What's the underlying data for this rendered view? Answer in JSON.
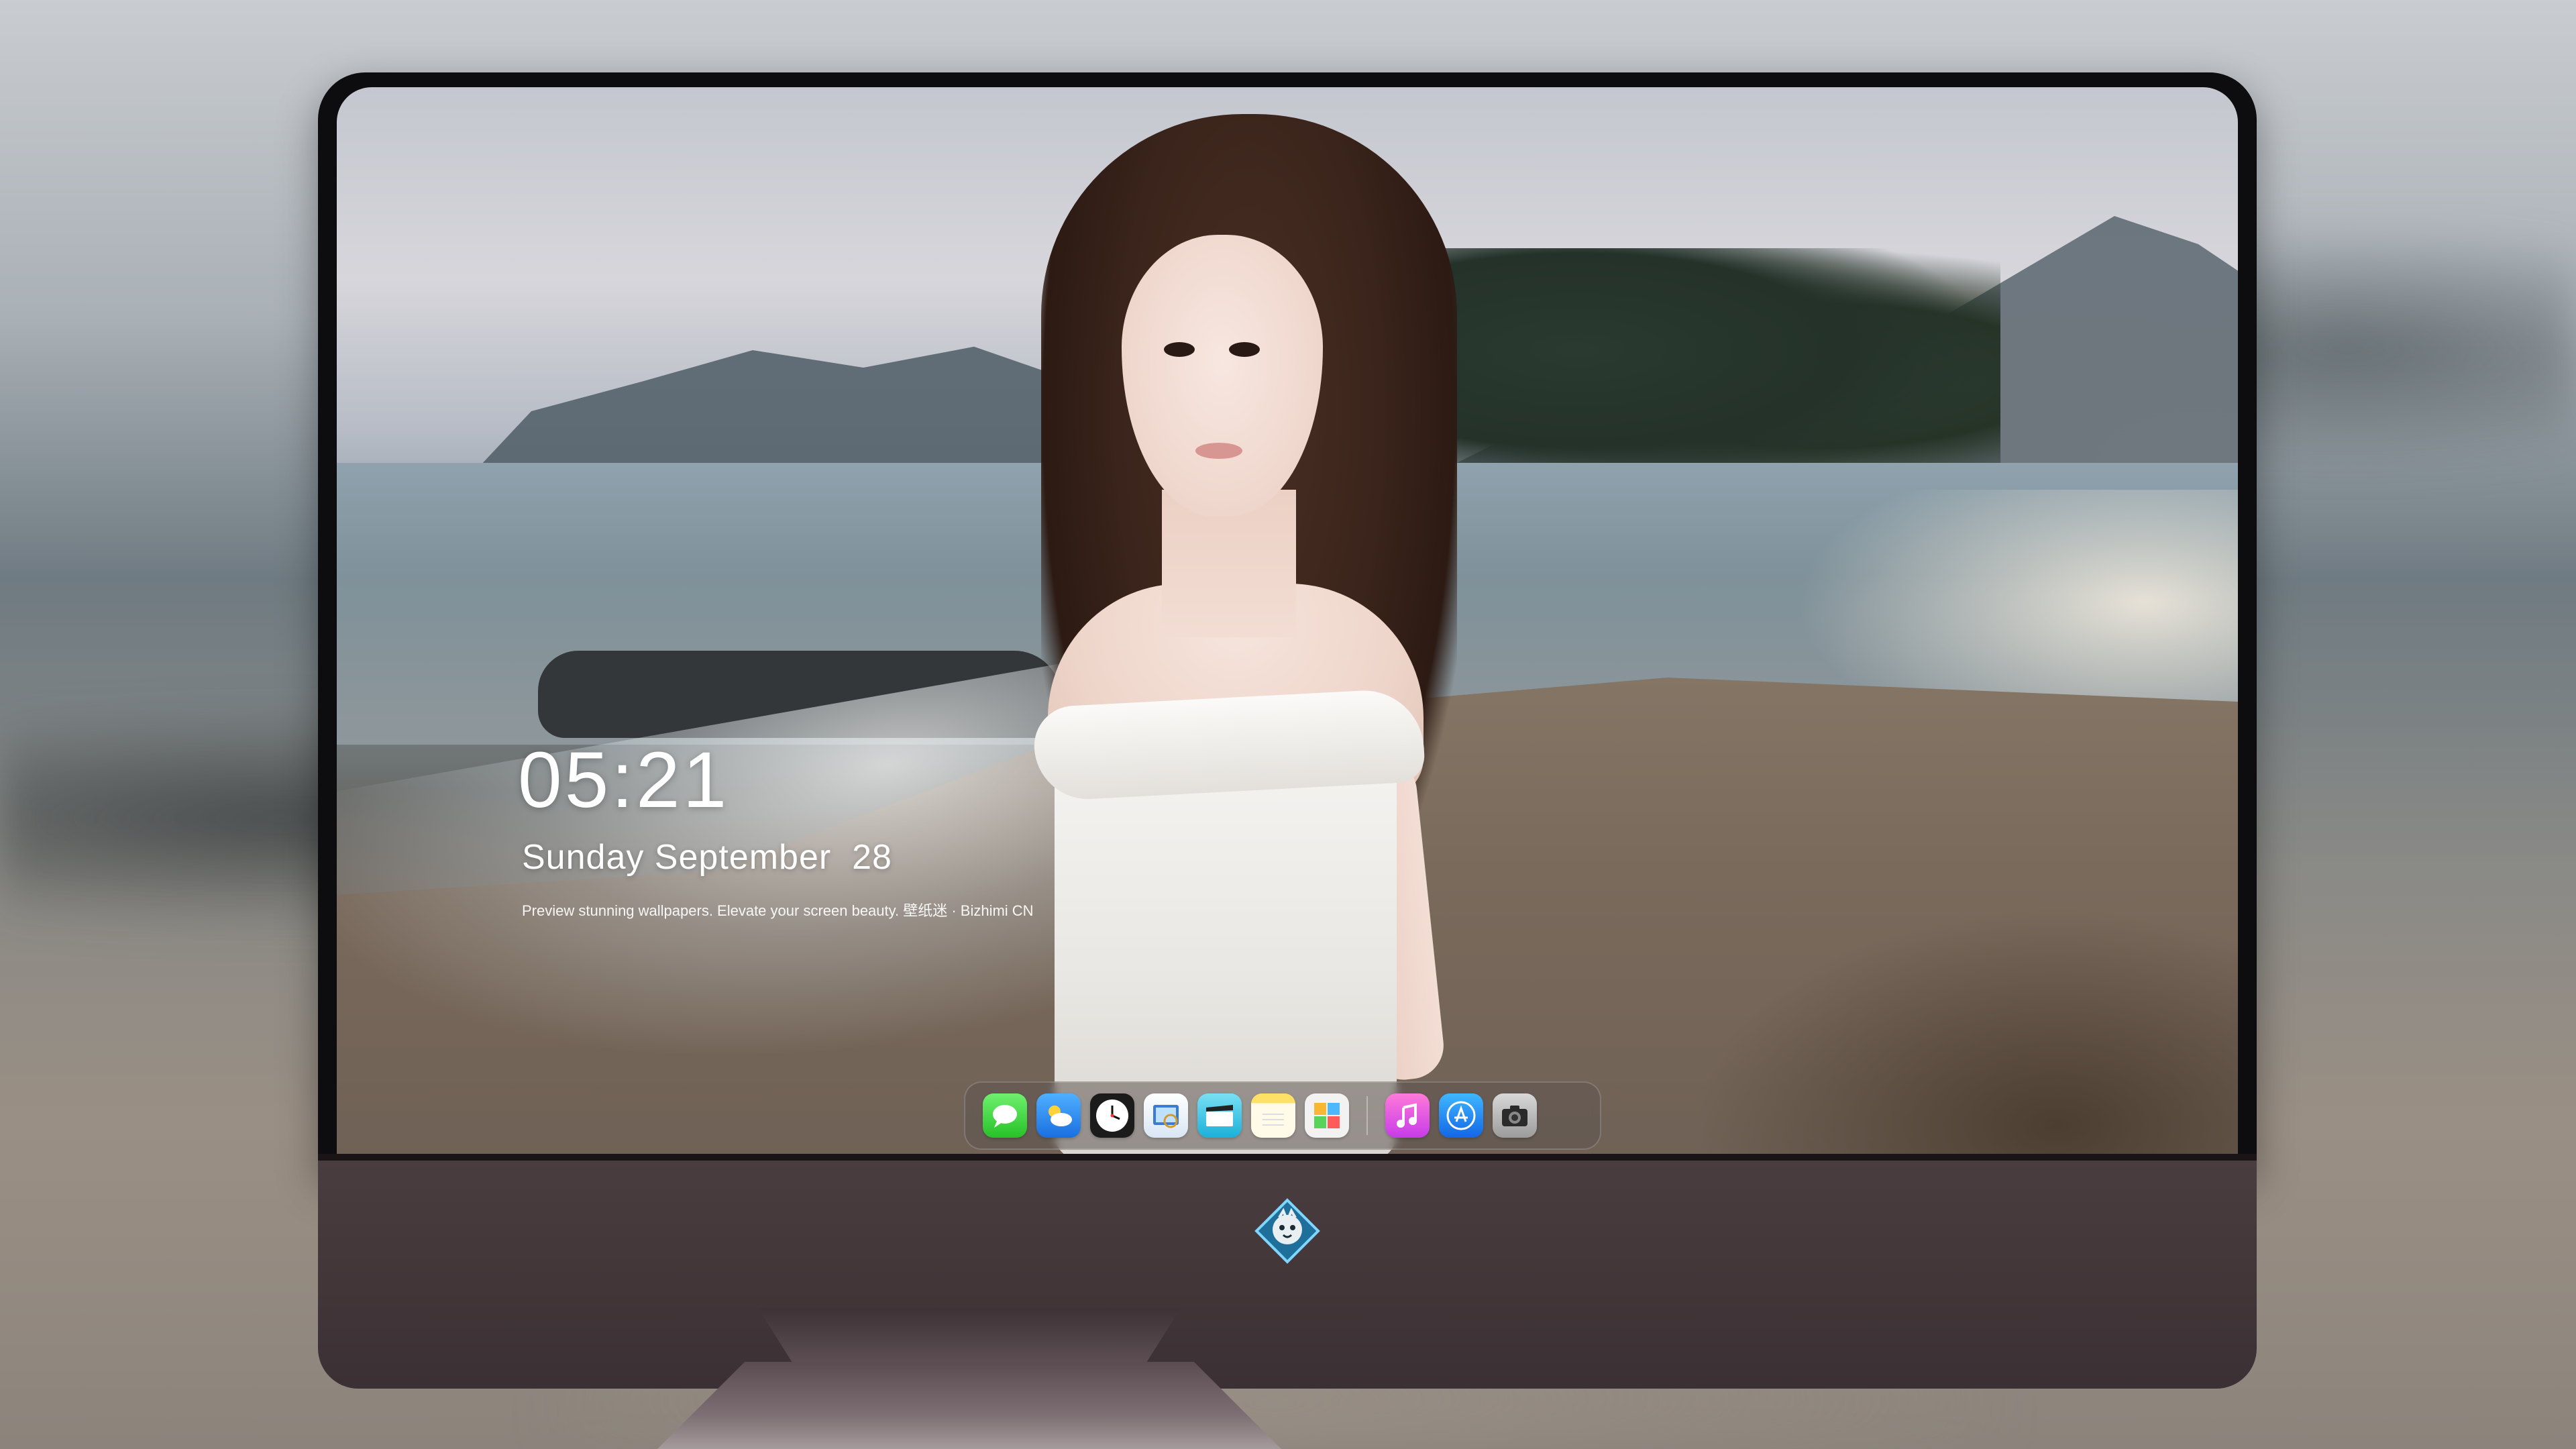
{
  "lockscreen": {
    "time": "05:21",
    "date": "Sunday September  28",
    "tagline": "Preview stunning wallpapers. Elevate your screen beauty. 壁纸迷 · Bizhimi CN"
  },
  "dock": {
    "apps": [
      {
        "name": "messages-icon"
      },
      {
        "name": "weather-icon"
      },
      {
        "name": "clock-icon"
      },
      {
        "name": "preview-icon"
      },
      {
        "name": "video-icon"
      },
      {
        "name": "notes-icon"
      },
      {
        "name": "photos-icon"
      },
      {
        "name": "music-icon"
      },
      {
        "name": "app-store-icon"
      },
      {
        "name": "camera-icon"
      }
    ]
  },
  "colors": {
    "monitor_bezel": "#0d0d10",
    "monitor_chin": "#4a3d3f",
    "clock_text": "#ffffff"
  }
}
